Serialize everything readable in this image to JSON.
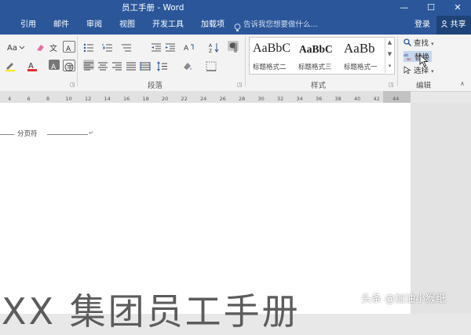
{
  "window": {
    "title": "员工手册 - Word",
    "minimize": "—",
    "maximize": "☐",
    "close": "✕"
  },
  "tabs": [
    "引用",
    "邮件",
    "审阅",
    "视图",
    "开发工具",
    "加载项"
  ],
  "tell_me": "告诉我您想要做什么...",
  "account": {
    "login": "登录",
    "share": "共享"
  },
  "groups": {
    "paragraph": "段落",
    "styles": "样式",
    "editing": "编辑"
  },
  "styles": [
    {
      "sample": "AaBbC",
      "name": "标题格式二"
    },
    {
      "sample": "AaBbC",
      "name": "标题格式三"
    },
    {
      "sample": "AaBb",
      "name": "标题格式一"
    }
  ],
  "editing": {
    "find": "查找",
    "replace": "替换",
    "select": "选择"
  },
  "ruler": [
    "4",
    "6",
    "8",
    "10",
    "12",
    "14",
    "16",
    "18",
    "20",
    "22",
    "24",
    "26",
    "28",
    "30",
    "32",
    "34",
    "36",
    "38",
    "40",
    "42",
    "44"
  ],
  "document": {
    "page_break": "分页符",
    "heading": "XX 集团员工手册"
  },
  "watermark": "头条 @加油小猴纸",
  "colors": {
    "word_blue": "#2b579a",
    "ribbon_bg": "#f3f3f3",
    "font_red": "#e03030",
    "highlight_yellow": "#ffe800"
  }
}
